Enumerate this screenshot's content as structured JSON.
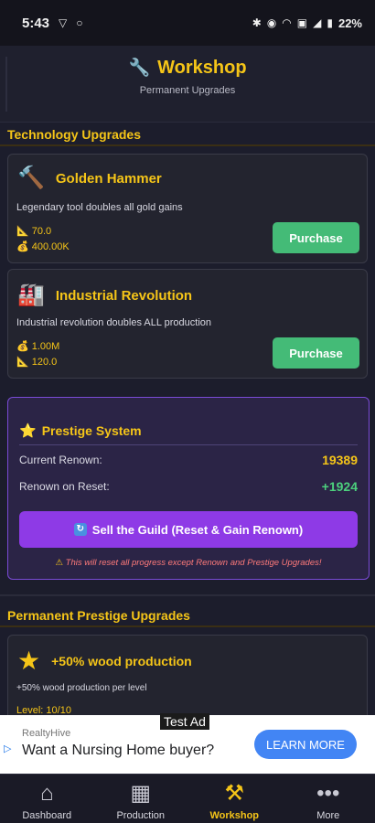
{
  "status_bar": {
    "time": "5:43",
    "battery": "22%",
    "left_icons": [
      "v-shield-icon",
      "circle-icon"
    ],
    "right_icons": [
      "bluetooth-icon",
      "location-icon",
      "wifi-icon",
      "volte-icon",
      "signal-icon",
      "battery-icon"
    ]
  },
  "header": {
    "icon": "wrench-icon",
    "title": "Workshop",
    "subtitle": "Permanent Upgrades"
  },
  "tech_section": {
    "title": "Technology Upgrades",
    "cards": [
      {
        "icon": "hammer-icon",
        "title": "Golden Hammer",
        "description": "Legendary tool doubles all gold gains",
        "stat1": {
          "icon": "ruler-icon",
          "value": "70.0"
        },
        "stat2": {
          "icon": "money-bag-icon",
          "value": "400.00K"
        },
        "button": "Purchase"
      },
      {
        "icon": "factory-icon",
        "title": "Industrial Revolution",
        "description": "Industrial revolution doubles ALL production",
        "stat1": {
          "icon": "money-bag-icon",
          "value": "1.00M"
        },
        "stat2": {
          "icon": "ruler-icon",
          "value": "120.0"
        },
        "button": "Purchase"
      }
    ]
  },
  "prestige": {
    "icon": "star-icon",
    "title": "Prestige System",
    "current_renown_label": "Current Renown:",
    "current_renown_value": "19389",
    "renown_on_reset_label": "Renown on Reset:",
    "renown_on_reset_value": "+1924",
    "sell_button": "Sell the Guild (Reset & Gain Renown)",
    "warning": "This will reset all progress except Renown and Prestige Upgrades!"
  },
  "prestige_upgrades": {
    "title": "Permanent Prestige Upgrades",
    "cards": [
      {
        "icon": "star-icon",
        "title": "+50% wood production",
        "description": "+50% wood production per level",
        "level": "Level: 10/10"
      }
    ]
  },
  "ad": {
    "tag": "Test Ad",
    "advertiser": "RealtyHive",
    "headline": "Want a Nursing Home buyer?",
    "cta": "LEARN MORE"
  },
  "nav": {
    "items": [
      {
        "label": "Dashboard",
        "icon": "house-icon",
        "active": false
      },
      {
        "label": "Production",
        "icon": "building-icon",
        "active": false
      },
      {
        "label": "Workshop",
        "icon": "tools-icon",
        "active": true
      },
      {
        "label": "More",
        "icon": "dots-icon",
        "active": false
      }
    ]
  },
  "colors": {
    "accent_gold": "#f5c518",
    "purchase_green": "#44bb77",
    "prestige_purple": "#8e3ae6",
    "renown_green": "#4cd07d",
    "warning_red": "#ff7a7a"
  }
}
